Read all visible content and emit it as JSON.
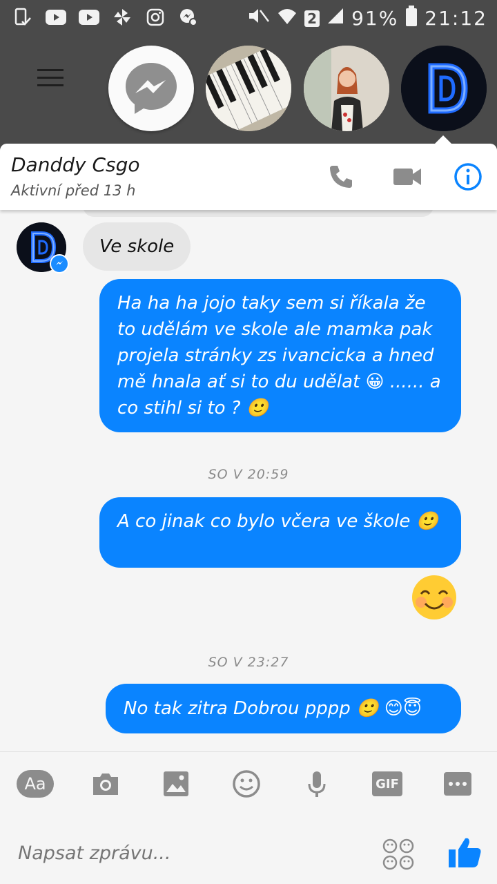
{
  "status_bar": {
    "left_icons": [
      "phone-check-icon",
      "youtube-icon",
      "youtube-icon",
      "pinwheel-icon",
      "instagram-icon",
      "messenger-notification-icon"
    ],
    "sim_number": "2",
    "battery": "91%",
    "time": "21:12"
  },
  "chat_heads": [
    "messenger-icon",
    "piano-avatar",
    "girl-avatar",
    "d-logo-avatar"
  ],
  "header": {
    "name": "Danddy Csgo",
    "status": "Aktivní před 13 h"
  },
  "messages": {
    "incoming_text": "Ve skole",
    "out1": "Ha ha ha jojo taky sem si říkala že to udělám ve skole ale mamka pak projela stránky zs ivancicka a hned mě hnala ať si to du udělat 😀 ...... a co stihl si to ? 🙂",
    "time1": "SO V 20:59",
    "out2": "A co jinak co bylo včera ve škole 🙂",
    "time2": "SO V 23:27",
    "out3": "No tak zitra Dobrou pppp 🙂 😊😇"
  },
  "toolbar": {
    "aa_label": "Aa",
    "gif_label": "GIF"
  },
  "composer": {
    "placeholder": "Napsat zprávu..."
  },
  "colors": {
    "accent": "#0a84ff",
    "incoming_bubble": "#e6e6e6",
    "status_bar": "#4a4a4a"
  }
}
